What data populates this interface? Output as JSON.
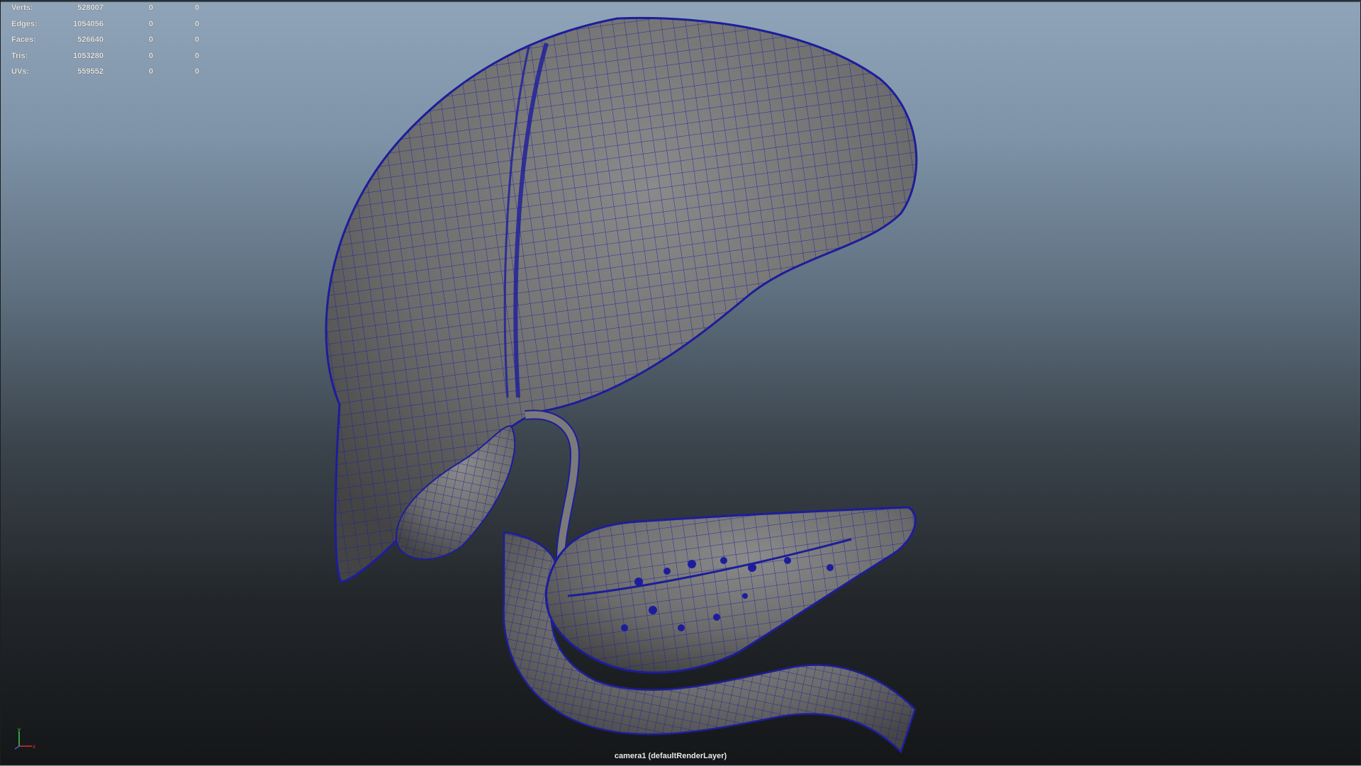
{
  "hud": {
    "rows": [
      {
        "label": "Verts:",
        "values": [
          "528007",
          "0",
          "0"
        ]
      },
      {
        "label": "Edges:",
        "values": [
          "1054056",
          "0",
          "0"
        ]
      },
      {
        "label": "Faces:",
        "values": [
          "526640",
          "0",
          "0"
        ]
      },
      {
        "label": "Tris:",
        "values": [
          "1053280",
          "0",
          "0"
        ]
      },
      {
        "label": "UVs:",
        "values": [
          "559552",
          "0",
          "0"
        ]
      }
    ]
  },
  "axis": {
    "y_label": "y",
    "x_label": "x"
  },
  "camera_label": "camera1 (defaultRenderLayer)",
  "colors": {
    "wireframe": "#1d1d9c",
    "mesh_fill": "#6e6e6e",
    "axis_x": "#d83030",
    "axis_y": "#3fd04a",
    "axis_z": "#3a5fe0"
  },
  "scene": {
    "objects": [
      "liver-mesh",
      "gallbladder-mesh",
      "bile-duct-mesh",
      "pancreas-mesh",
      "duodenum-mesh"
    ]
  }
}
